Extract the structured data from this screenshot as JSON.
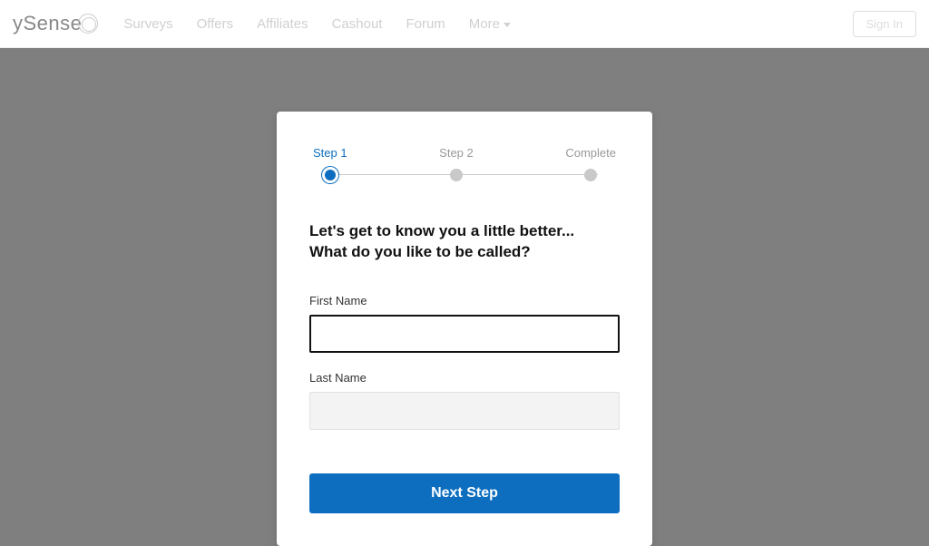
{
  "brand": "ySense",
  "nav": {
    "items": [
      "Surveys",
      "Offers",
      "Affiliates",
      "Cashout",
      "Forum",
      "More"
    ]
  },
  "signin_label": "Sign In",
  "steps": {
    "step1": "Step 1",
    "step2": "Step 2",
    "complete": "Complete"
  },
  "heading_line1": "Let's get to know you a little better...",
  "heading_line2": "What do you like to be called?",
  "first_name_label": "First Name",
  "first_name_value": "",
  "last_name_label": "Last Name",
  "last_name_value": "",
  "next_button": "Next Step"
}
